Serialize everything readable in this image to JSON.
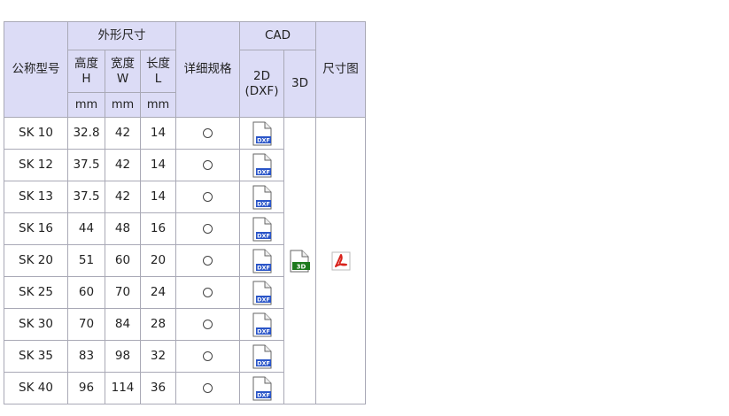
{
  "headers": {
    "model": "公称型号",
    "dimensions": "外形尺寸",
    "height": "高度\nH",
    "width": "宽度\nW",
    "length": "长度\nL",
    "unit": "mm",
    "spec": "详细规格",
    "cad": "CAD",
    "cad2d": "2D\n(DXF)",
    "cad3d": "3D",
    "drawing": "尺寸图"
  },
  "icons": {
    "dxf_label": "DXF",
    "threed_label": "3D"
  },
  "rows": [
    {
      "model": "SK 10",
      "h": "32.8",
      "w": "42",
      "l": "14"
    },
    {
      "model": "SK 12",
      "h": "37.5",
      "w": "42",
      "l": "14"
    },
    {
      "model": "SK 13",
      "h": "37.5",
      "w": "42",
      "l": "14"
    },
    {
      "model": "SK 16",
      "h": "44",
      "w": "48",
      "l": "16"
    },
    {
      "model": "SK 20",
      "h": "51",
      "w": "60",
      "l": "20"
    },
    {
      "model": "SK 25",
      "h": "60",
      "w": "70",
      "l": "24"
    },
    {
      "model": "SK 30",
      "h": "70",
      "w": "84",
      "l": "28"
    },
    {
      "model": "SK 35",
      "h": "83",
      "w": "98",
      "l": "32"
    },
    {
      "model": "SK 40",
      "h": "96",
      "w": "114",
      "l": "36"
    }
  ],
  "colors": {
    "header_bg": "#dcdcf6",
    "border": "#a9a9b6",
    "dxf_blue": "#2a55c8",
    "threed_green": "#1f7a1f",
    "pdf_red": "#d9231c"
  }
}
